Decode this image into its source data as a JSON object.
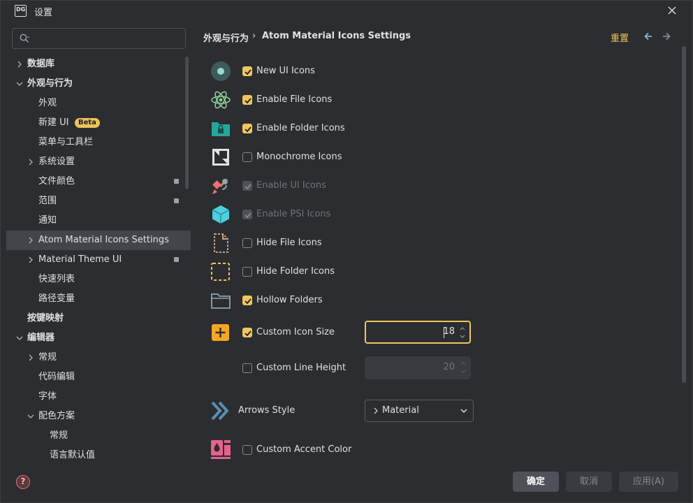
{
  "window": {
    "title": "设置",
    "logo_text": "DG"
  },
  "search": {
    "placeholder": ""
  },
  "sidebar": {
    "items": [
      {
        "label": "数据库",
        "level": 0,
        "chevron": "right",
        "bold": true
      },
      {
        "label": "外观与行为",
        "level": 0,
        "chevron": "down",
        "bold": true
      },
      {
        "label": "外观",
        "level": 1
      },
      {
        "label": "新建 UI",
        "level": 1,
        "badge": "Beta"
      },
      {
        "label": "菜单与工具栏",
        "level": 1
      },
      {
        "label": "系统设置",
        "level": 1,
        "chevron": "right"
      },
      {
        "label": "文件颜色",
        "level": 1,
        "pin": true
      },
      {
        "label": "范围",
        "level": 1,
        "pin": true
      },
      {
        "label": "通知",
        "level": 1
      },
      {
        "label": "Atom Material Icons Settings",
        "level": 1,
        "chevron": "right",
        "selected": true
      },
      {
        "label": "Material Theme UI",
        "level": 1,
        "chevron": "right",
        "pin": true
      },
      {
        "label": "快速列表",
        "level": 1
      },
      {
        "label": "路径变量",
        "level": 1
      },
      {
        "label": "按键映射",
        "level": 0,
        "bold": true
      },
      {
        "label": "编辑器",
        "level": 0,
        "chevron": "down",
        "bold": true
      },
      {
        "label": "常规",
        "level": 1,
        "chevron": "right"
      },
      {
        "label": "代码编辑",
        "level": 1
      },
      {
        "label": "字体",
        "level": 1
      },
      {
        "label": "配色方案",
        "level": 1,
        "chevron": "down"
      },
      {
        "label": "常规",
        "level": 2
      },
      {
        "label": "语言默认值",
        "level": 2
      }
    ]
  },
  "breadcrumb": {
    "parent": "外观与行为",
    "sep": "›",
    "current": "Atom Material Icons Settings"
  },
  "header": {
    "reset_label": "重置"
  },
  "options": [
    {
      "key": "new_ui_icons",
      "label": "New UI Icons",
      "checked": true,
      "disabled": false,
      "icon": "new-ui-icon"
    },
    {
      "key": "enable_file_icons",
      "label": "Enable File Icons",
      "checked": true,
      "disabled": false,
      "icon": "atom-icon"
    },
    {
      "key": "enable_folder_icons",
      "label": "Enable Folder Icons",
      "checked": true,
      "disabled": false,
      "icon": "folder-lock-icon"
    },
    {
      "key": "monochrome_icons",
      "label": "Monochrome Icons",
      "checked": false,
      "disabled": false,
      "icon": "monochrome-icon"
    },
    {
      "key": "enable_ui_icons",
      "label": "Enable UI Icons",
      "checked": true,
      "disabled": true,
      "icon": "satellite-icon"
    },
    {
      "key": "enable_psi_icons",
      "label": "Enable PSI Icons",
      "checked": true,
      "disabled": true,
      "icon": "cube-icon"
    },
    {
      "key": "hide_file_icons",
      "label": "Hide File Icons",
      "checked": false,
      "disabled": false,
      "icon": "dashed-file-icon"
    },
    {
      "key": "hide_folder_icons",
      "label": "Hide Folder Icons",
      "checked": false,
      "disabled": false,
      "icon": "dashed-folder-icon"
    },
    {
      "key": "hollow_folders",
      "label": "Hollow Folders",
      "checked": true,
      "disabled": false,
      "icon": "hollow-folder-icon"
    }
  ],
  "custom_icon_size": {
    "label": "Custom Icon Size",
    "checked": true,
    "value": "18"
  },
  "custom_line_height": {
    "label": "Custom Line Height",
    "checked": false,
    "value": "20"
  },
  "arrows_style": {
    "label": "Arrows Style",
    "value": "Material",
    "prefix": "›"
  },
  "custom_accent_color": {
    "label": "Custom Accent Color",
    "checked": false
  },
  "footer": {
    "ok": "确定",
    "cancel": "取消",
    "apply": "应用(A)"
  },
  "colors": {
    "accent": "#f2c55c",
    "background": "#2b2d30",
    "selected": "#43454a"
  }
}
